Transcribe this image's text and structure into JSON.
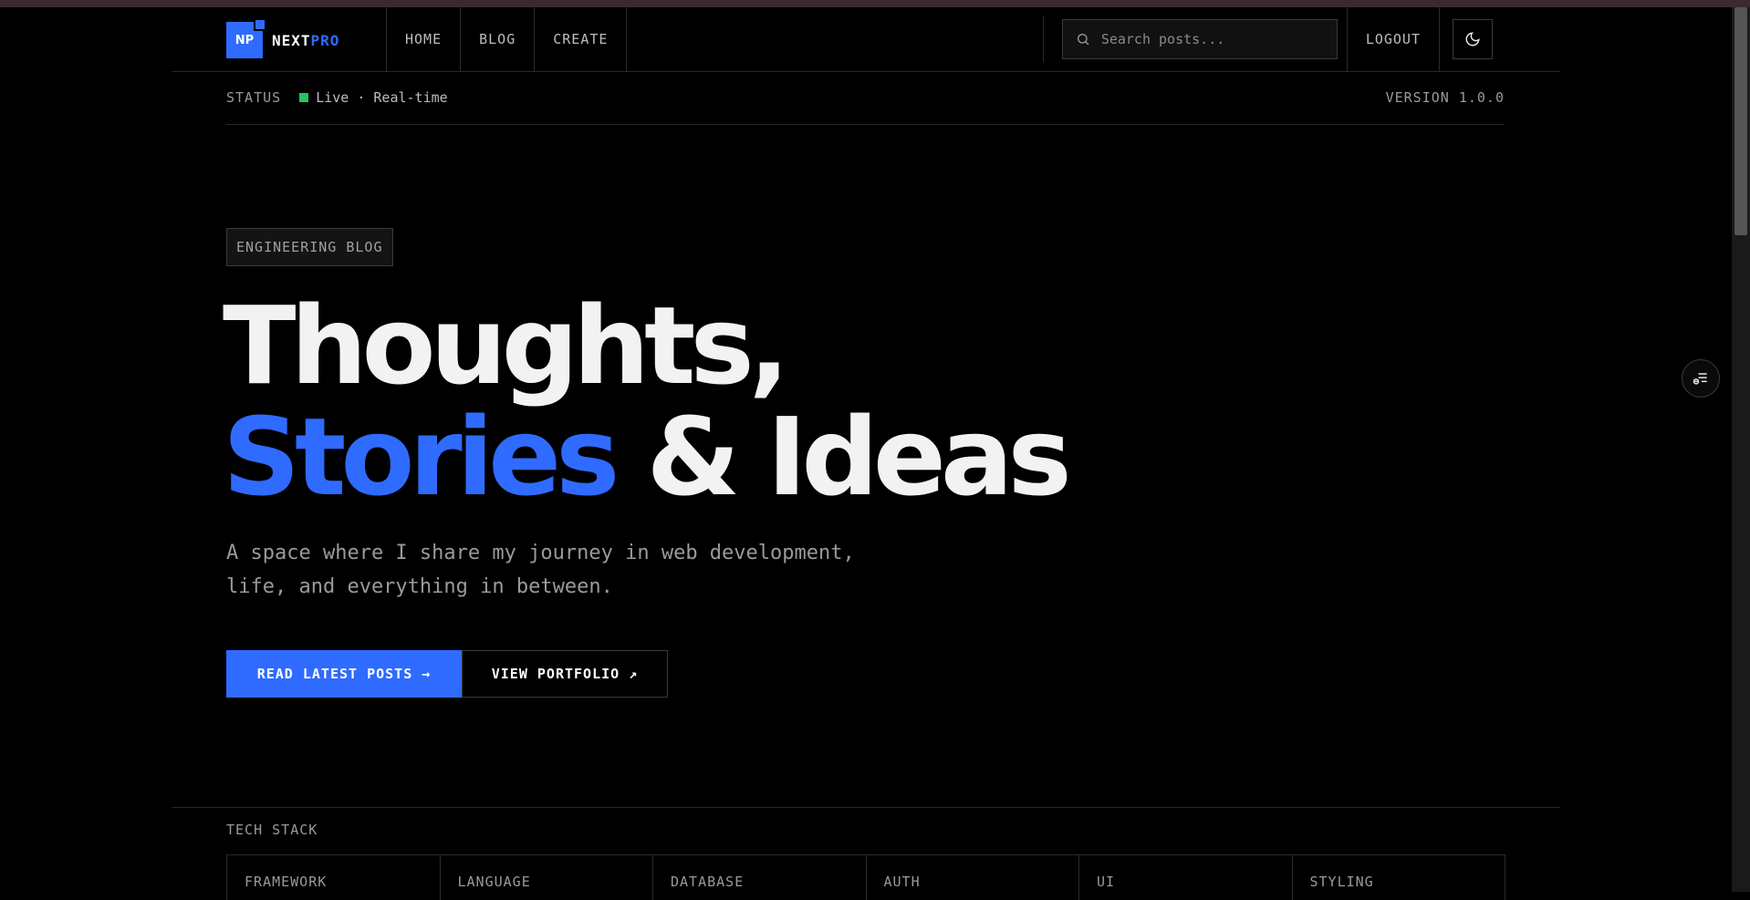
{
  "brand": {
    "logo_mark": "NP",
    "name_part1": "NEXT",
    "name_part2": "PRO"
  },
  "nav": {
    "items": [
      {
        "label": "HOME"
      },
      {
        "label": "BLOG"
      },
      {
        "label": "CREATE"
      }
    ]
  },
  "search": {
    "placeholder": "Search posts..."
  },
  "actions": {
    "logout_label": "LOGOUT"
  },
  "status": {
    "label": "STATUS",
    "value": "Live · Real-time",
    "version": "VERSION 1.0.0"
  },
  "hero": {
    "badge": "ENGINEERING BLOG",
    "title_line1": "Thoughts,",
    "title_highlight": "Stories",
    "title_rest": " & Ideas",
    "subtitle": "A space where I share my journey in web development, life, and everything in between.",
    "primary_button": "READ LATEST POSTS →",
    "secondary_button": "VIEW PORTFOLIO ↗"
  },
  "tech_stack": {
    "label": "TECH STACK",
    "categories": [
      "FRAMEWORK",
      "LANGUAGE",
      "DATABASE",
      "AUTH",
      "UI",
      "STYLING"
    ]
  },
  "colors": {
    "accent": "#2f6bff",
    "status_live": "#22c55e",
    "background": "#000000"
  },
  "icons": {
    "search": "search-icon",
    "theme": "moon-icon",
    "floating": "toc-icon"
  }
}
